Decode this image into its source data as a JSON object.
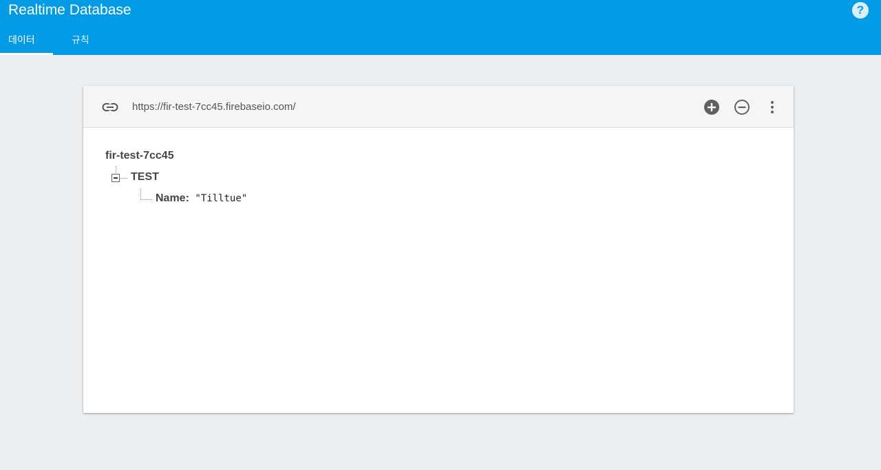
{
  "app": {
    "title": "Realtime Database",
    "help_icon": "help-circle-icon",
    "accent": "#039be5"
  },
  "tabs": [
    {
      "label": "데이터",
      "active": true
    },
    {
      "label": "규칙",
      "active": false
    }
  ],
  "database": {
    "url": "https://fir-test-7cc45.firebaseio.com/",
    "toolbar_icons": [
      "link-icon",
      "add-circle-icon",
      "remove-circle-icon",
      "more-vert-icon"
    ],
    "tree": {
      "root": "fir-test-7cc45",
      "child": {
        "key": "TEST",
        "expanded": true,
        "leaf": {
          "key": "Name:",
          "value": "\"Tilltue\""
        }
      }
    }
  }
}
